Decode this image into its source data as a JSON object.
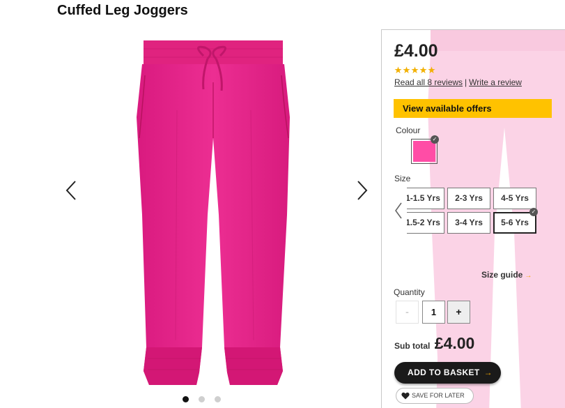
{
  "product": {
    "title": "Cuffed Leg Joggers",
    "price": "£4.00",
    "rating": 5,
    "rating_max": 5,
    "reviews_link": "Read all 8 reviews",
    "write_review": "Write a review",
    "separator": "|",
    "color_hex": "#ff4da6",
    "accent_color": "#ffc200"
  },
  "offers": {
    "label": "View available offers"
  },
  "colour": {
    "label": "Colour",
    "selected_icon": "check-icon"
  },
  "size": {
    "label": "Size",
    "options": [
      "1-1.5 Yrs",
      "2-3 Yrs",
      "4-5 Yrs",
      "1.5-2 Yrs",
      "3-4 Yrs",
      "5-6 Yrs"
    ],
    "selected": "5-6 Yrs",
    "guide": "Size guide"
  },
  "quantity": {
    "label": "Quantity",
    "value": "1",
    "minus": "-",
    "plus": "+"
  },
  "subtotal": {
    "label": "Sub total",
    "value": "£4.00"
  },
  "actions": {
    "basket": "ADD TO BASKET",
    "save": "SAVE FOR LATER"
  },
  "gallery": {
    "image_count": 3,
    "active_index": 0
  }
}
